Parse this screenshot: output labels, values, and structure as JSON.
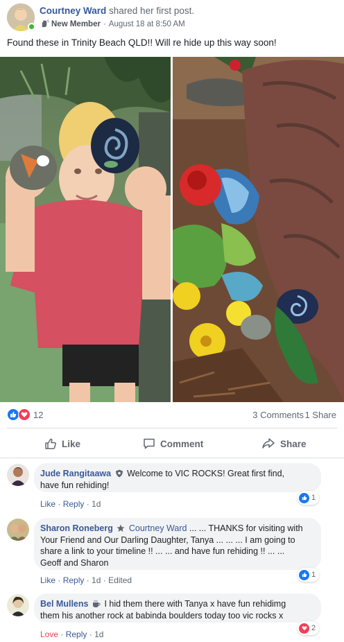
{
  "post": {
    "author": "Courtney Ward",
    "action": "shared her first post.",
    "badge": "New Member",
    "timestamp": "August 18 at 8:50 AM",
    "text": "Found these in Trinity Beach QLD!! Will re hide up this way soon!"
  },
  "reactions": {
    "count": "12",
    "comments": "3 Comments",
    "shares": "1 Share"
  },
  "actions": {
    "like": "Like",
    "comment": "Comment",
    "share": "Share"
  },
  "comments": [
    {
      "author": "Jude Rangitaawa",
      "badge_icon": "shield-icon",
      "line1": "Welcome to VIC ROCKS! Great first find,",
      "line2": "have fun rehiding!",
      "like": "Like",
      "reply": "Reply",
      "time": "1d",
      "reaction_count": "1",
      "reaction_type": "like"
    },
    {
      "author": "Sharon Roneberg",
      "badge_icon": "star-icon",
      "tag": "Courtney Ward",
      "line1": " ... ... THANKS for visiting with",
      "line2": "Your Friend and Our Darling Daughter, Tanya ... ... ... I am going to",
      "line3": "share a link to your timeline !! ... ... and have fun rehiding !! ... ...",
      "line4": "Geoff and Sharon",
      "like": "Like",
      "reply": "Reply",
      "time": "1d",
      "edited": "Edited",
      "reaction_count": "1",
      "reaction_type": "like"
    },
    {
      "author": "Bel Mullens",
      "badge_icon": "coffee-cup-icon",
      "line1": "I hid them there with Tanya x have fun rehidimg",
      "line2": "them his another rock at babinda boulders today too vic rocks x",
      "like": "Love",
      "reply": "Reply",
      "time": "1d",
      "reaction_count": "2",
      "reaction_type": "love"
    }
  ],
  "colors": {
    "link_blue": "#385898",
    "like_blue": "#1877f2",
    "love_red": "#f33e58",
    "online_green": "#42b72a",
    "bubble_gray": "#f2f3f5"
  }
}
